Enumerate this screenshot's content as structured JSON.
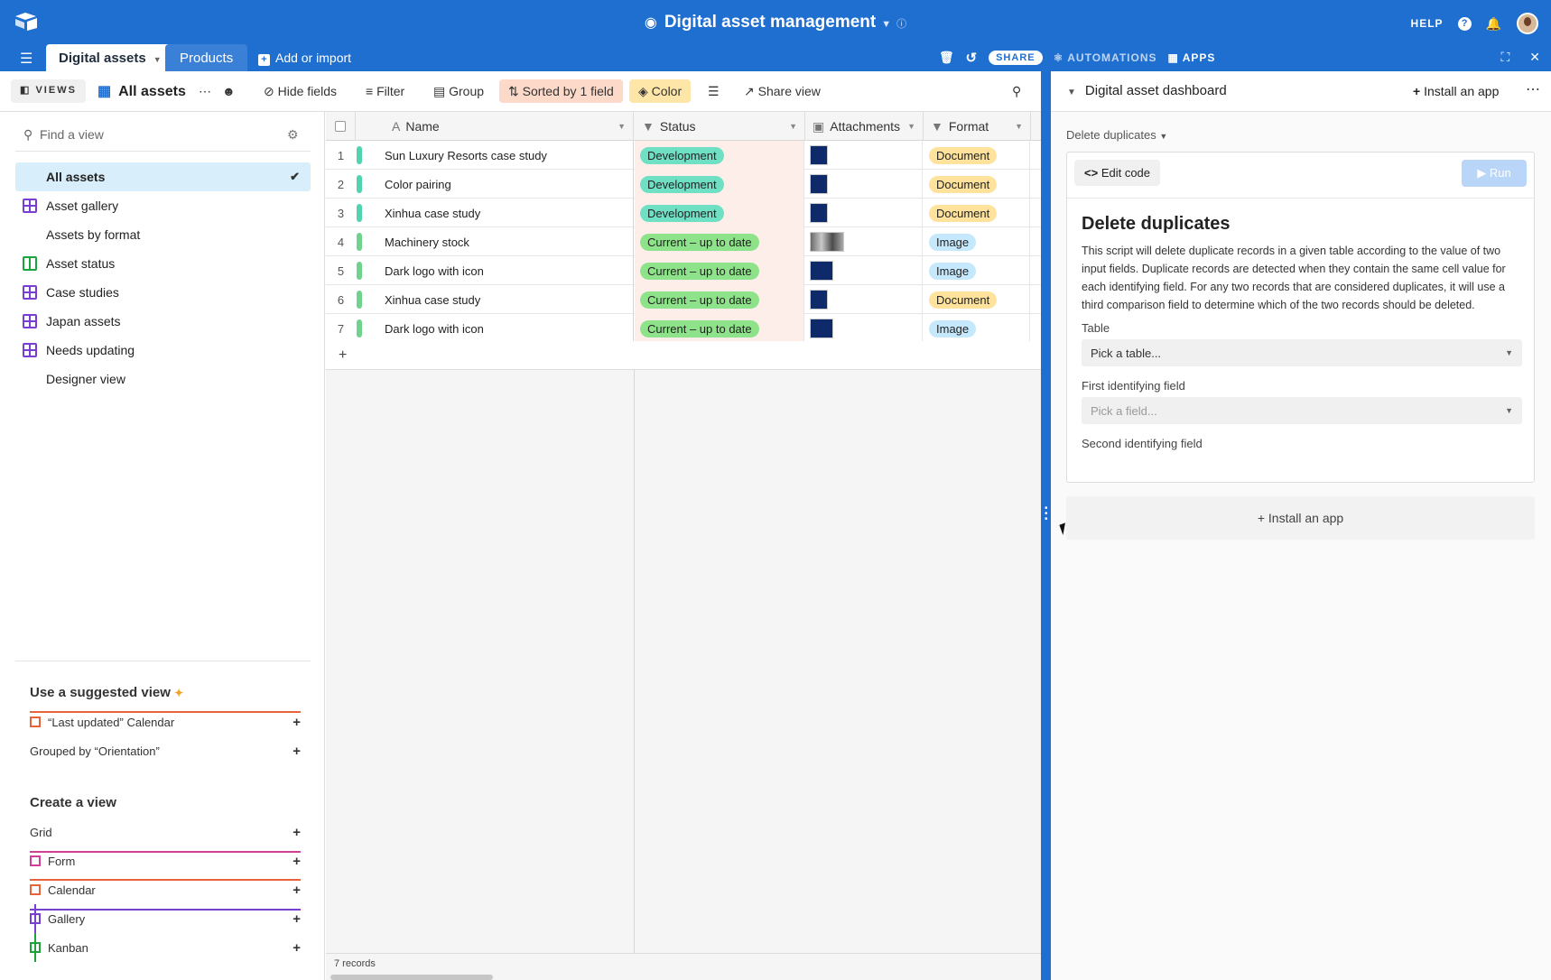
{
  "app": {
    "title": "Digital asset management",
    "help": "HELP"
  },
  "tabs": {
    "active": "Digital assets",
    "other": "Products",
    "add_import": "Add or import",
    "share": "SHARE",
    "automations": "AUTOMATIONS",
    "apps": "APPS"
  },
  "toolbar": {
    "views": "VIEWS",
    "view_name": "All assets",
    "hide_fields": "Hide fields",
    "filter": "Filter",
    "group": "Group",
    "sorted": "Sorted by 1 field",
    "color": "Color",
    "share_view": "Share view"
  },
  "sidebar": {
    "find_placeholder": "Find a view",
    "views": [
      {
        "label": "All assets",
        "icon": "grid"
      },
      {
        "label": "Asset gallery",
        "icon": "gallery"
      },
      {
        "label": "Assets by format",
        "icon": "grid"
      },
      {
        "label": "Asset status",
        "icon": "kanban"
      },
      {
        "label": "Case studies",
        "icon": "gallery"
      },
      {
        "label": "Japan assets",
        "icon": "gallery"
      },
      {
        "label": "Needs updating",
        "icon": "gallery"
      },
      {
        "label": "Designer view",
        "icon": "grid"
      }
    ],
    "suggested_title": "Use a suggested view",
    "suggested": [
      {
        "label": "“Last updated” Calendar",
        "icon": "cal"
      },
      {
        "label": "Grouped by “Orientation”",
        "icon": "grid"
      }
    ],
    "create_title": "Create a view",
    "create": [
      {
        "label": "Grid",
        "icon": "grid"
      },
      {
        "label": "Form",
        "icon": "form"
      },
      {
        "label": "Calendar",
        "icon": "cal"
      },
      {
        "label": "Gallery",
        "icon": "gallery"
      },
      {
        "label": "Kanban",
        "icon": "kanban"
      }
    ]
  },
  "grid": {
    "columns": {
      "name": "Name",
      "status": "Status",
      "attachments": "Attachments",
      "format": "Format"
    },
    "rows": [
      {
        "num": "1",
        "name": "Sun Luxury Resorts case study",
        "status": "Development",
        "format": "Document"
      },
      {
        "num": "2",
        "name": "Color pairing",
        "status": "Development",
        "format": "Document"
      },
      {
        "num": "3",
        "name": "Xinhua case study",
        "status": "Development",
        "format": "Document"
      },
      {
        "num": "4",
        "name": "Machinery stock",
        "status": "Current – up to date",
        "format": "Image"
      },
      {
        "num": "5",
        "name": "Dark logo with icon",
        "status": "Current – up to date",
        "format": "Image"
      },
      {
        "num": "6",
        "name": "Xinhua case study",
        "status": "Current – up to date",
        "format": "Document"
      },
      {
        "num": "7",
        "name": "Dark logo with icon",
        "status": "Current – up to date",
        "format": "Image"
      }
    ],
    "record_count": "7 records"
  },
  "dashboard": {
    "title": "Digital asset dashboard",
    "install_app": "Install an app",
    "app_name": "Delete duplicates",
    "edit_code": "Edit code",
    "run": "Run",
    "script_title": "Delete duplicates",
    "script_desc": "This script will delete duplicate records in a given table according to the value of two input fields. Duplicate records are detected when they contain the same cell value for each identifying field. For any two records that are considered duplicates, it will use a third comparison field to determine which of the two records should be deleted.",
    "table_label": "Table",
    "table_placeholder": "Pick a table...",
    "first_field_label": "First identifying field",
    "first_field_placeholder": "Pick a field...",
    "second_field_label": "Second identifying field",
    "install_card": "Install an app"
  }
}
